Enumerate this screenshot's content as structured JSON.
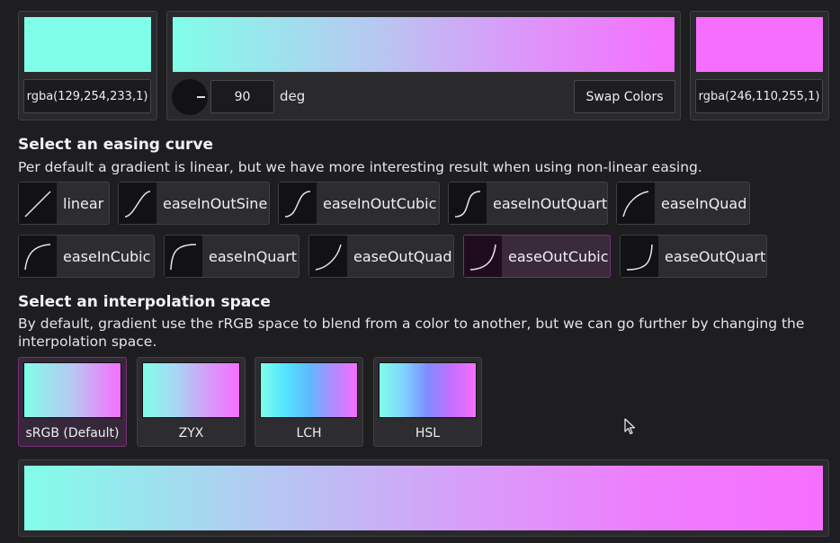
{
  "colors": {
    "start": "#81FEE9",
    "end": "#F66EFF",
    "selected_border": "#7a2f7a"
  },
  "start_color": {
    "value": "rgba(129,254,233,1)"
  },
  "end_color": {
    "value": "rgba(246,110,255,1)"
  },
  "angle": {
    "value": "90",
    "unit": "deg"
  },
  "swap_button": {
    "label": "Swap Colors"
  },
  "easing": {
    "title": "Select an easing curve",
    "description": "Per default a gradient is linear, but we have more interesting result when using non-linear easing.",
    "selected": "easeOutCubic",
    "options": [
      {
        "label": "linear"
      },
      {
        "label": "easeInOutSine"
      },
      {
        "label": "easeInOutCubic"
      },
      {
        "label": "easeInOutQuart"
      },
      {
        "label": "easeInQuad"
      },
      {
        "label": "easeInCubic"
      },
      {
        "label": "easeInQuart"
      },
      {
        "label": "easeOutQuad"
      },
      {
        "label": "easeOutCubic"
      },
      {
        "label": "easeOutQuart"
      }
    ]
  },
  "interpolation": {
    "title": "Select an interpolation space",
    "description_line1": "By default, gradient use the rRGB space to blend from a color to another, but we can go further by changing the",
    "description_line2": "interpolation space.",
    "selected": "sRGB (Default)",
    "options": [
      {
        "label": "sRGB (Default)"
      },
      {
        "label": "ZYX"
      },
      {
        "label": "LCH"
      },
      {
        "label": "HSL"
      }
    ]
  }
}
